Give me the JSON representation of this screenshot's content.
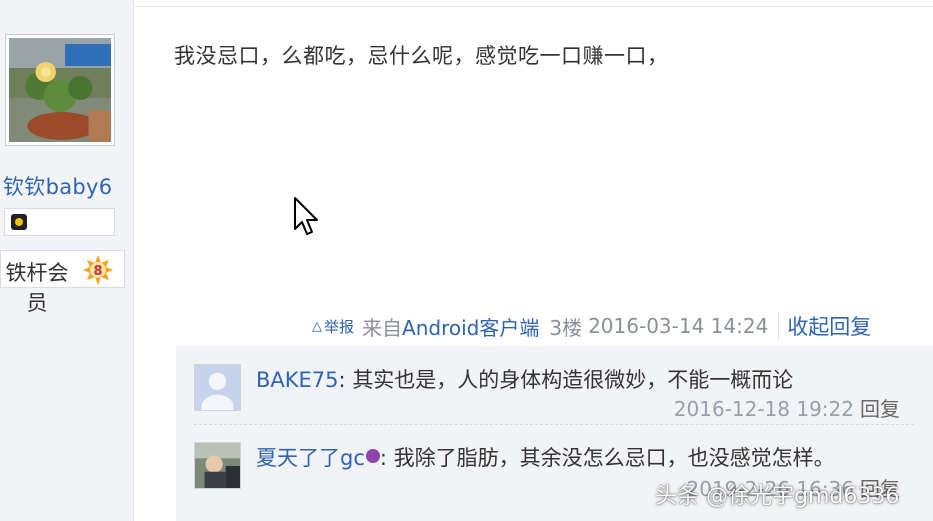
{
  "user": {
    "name": "钦钦baby6",
    "badge_label": "铁杆会员",
    "badge_level": "8"
  },
  "post": {
    "content": "我没忌口，么都吃，忌什么呢，感觉吃一口赚一口，",
    "report_label": "举报",
    "source_prefix": "来自",
    "source_client": "Android客户端",
    "floor": "3楼",
    "time": "2016-03-14 14:24",
    "collapse_label": "收起回复"
  },
  "replies": [
    {
      "user": "BAKE75",
      "text": "其实也是，人的身体构造很微妙，不能一概而论",
      "time": "2016-12-18 19:22",
      "reply_label": "回复"
    },
    {
      "user": "夏天了了gc",
      "text": "我除了脂肪，其余没怎么忌口，也没感觉怎样。",
      "time": "2019-2-26 16:36",
      "reply_label": "回复"
    }
  ],
  "watermark": "头条 @徐光宇gmd6336",
  "colors": {
    "link": "#2d64b3",
    "meta": "#8a8f99",
    "reply_bg": "#f2f3f6",
    "sidebar_bg": "#f3f4f7"
  }
}
